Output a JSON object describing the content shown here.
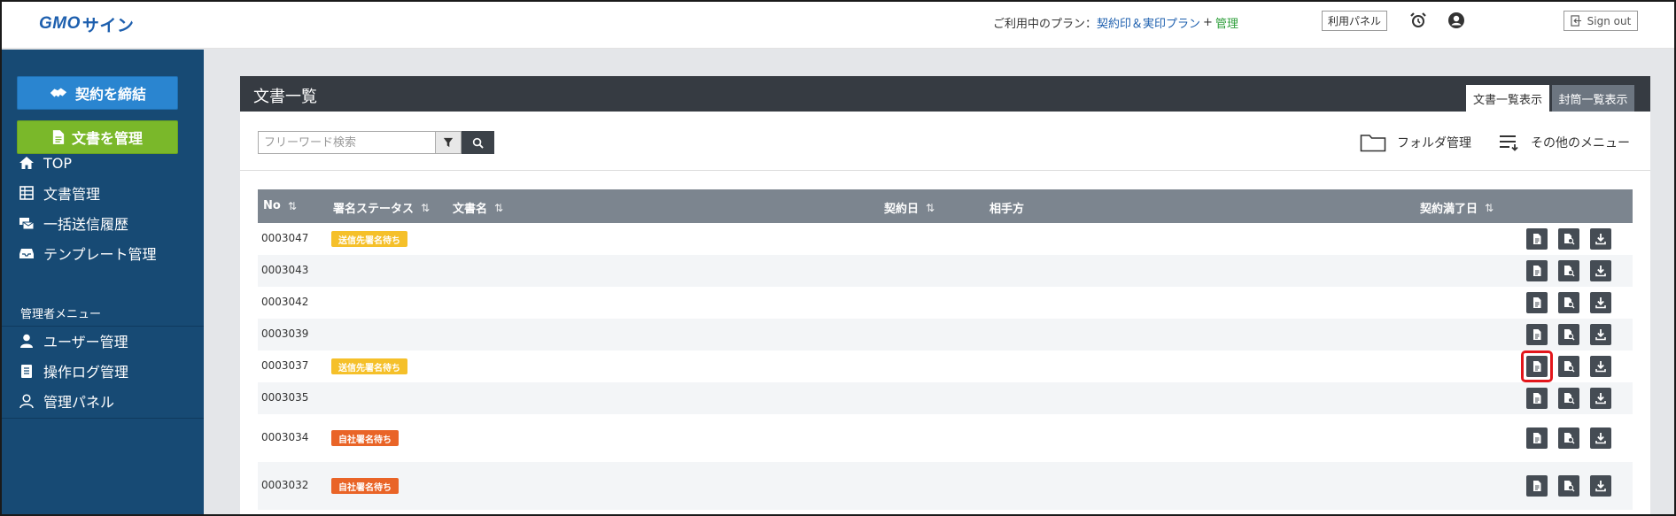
{
  "header": {
    "logo_gmo": "GMO",
    "logo_sign": "サイン",
    "plan_prefix": "ご利用中のプラン：",
    "plan_name": "契約印＆実印プラン",
    "plan_plus": "+",
    "plan_admin": "管理",
    "panel_button": "利用パネル",
    "signout_label": "Sign out"
  },
  "sidebar": {
    "contract_button": "契約を締結",
    "docs_button": "文書を管理",
    "items": [
      {
        "label": "TOP",
        "icon": "home-icon"
      },
      {
        "label": "文書管理",
        "icon": "table-icon"
      },
      {
        "label": "一括送信履歴",
        "icon": "bulk-send-icon"
      },
      {
        "label": "テンプレート管理",
        "icon": "inbox-icon"
      }
    ],
    "admin_label": "管理者メニュー",
    "admin_items": [
      {
        "label": "ユーザー管理",
        "icon": "user-icon"
      },
      {
        "label": "操作ログ管理",
        "icon": "clipboard-icon"
      },
      {
        "label": "管理パネル",
        "icon": "person-outline-icon"
      }
    ]
  },
  "main": {
    "title": "文書一覧",
    "tabs": [
      {
        "label": "文書一覧表示",
        "active": true
      },
      {
        "label": "封筒一覧表示",
        "active": false
      }
    ],
    "search_placeholder": "フリーワード検索",
    "folder_label": "フォルダ管理",
    "other_menu_label": "その他のメニュー",
    "columns": {
      "no": "No",
      "status": "署名ステータス",
      "doc_name": "文書名",
      "contract_date": "契約日",
      "party": "相手方",
      "end_date": "契約満了日"
    },
    "sort_glyph": "⇅",
    "rows": [
      {
        "no": "0003047",
        "status": "送信先署名待ち",
        "status_color": "yellow"
      },
      {
        "no": "0003043",
        "status": "",
        "status_color": ""
      },
      {
        "no": "0003042",
        "status": "",
        "status_color": ""
      },
      {
        "no": "0003039",
        "status": "",
        "status_color": ""
      },
      {
        "no": "0003037",
        "status": "送信先署名待ち",
        "status_color": "yellow",
        "highlighted": true
      },
      {
        "no": "0003035",
        "status": "",
        "status_color": ""
      },
      {
        "no": "0003034",
        "status": "自社署名待ち",
        "status_color": "orange"
      },
      {
        "no": "0003032",
        "status": "自社署名待ち",
        "status_color": "orange"
      }
    ]
  },
  "colors": {
    "sidebar_bg": "#174a74",
    "contract_btn": "#2a85d0",
    "docs_btn": "#7ab82a",
    "header_dark": "#363b42",
    "table_head": "#7c858f",
    "badge_yellow": "#f5c02a",
    "badge_orange": "#e96427",
    "highlight": "#e3161b"
  }
}
